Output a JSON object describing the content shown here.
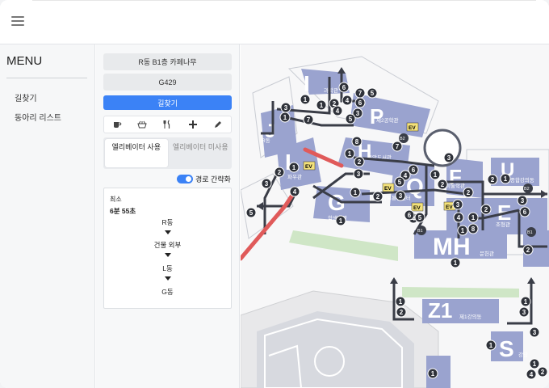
{
  "menu": {
    "title": "MENU",
    "items": [
      {
        "label": "길찾기"
      },
      {
        "label": "동아리 리스트"
      }
    ]
  },
  "route_form": {
    "origin": "R동 B1층 카페나무",
    "destination": "G429",
    "search_label": "길찾기",
    "icons": [
      "cafe-icon",
      "restaurant-icon",
      "utensils-icon",
      "plus-icon",
      "pencil-icon"
    ],
    "tabs": [
      {
        "label": "엘리베이터 사용",
        "active": true
      },
      {
        "label": "엘리베이터 미사용",
        "active": false
      }
    ],
    "simplify_toggle": {
      "label": "경로 간략화",
      "on": true
    }
  },
  "route_result": {
    "type": "최소",
    "time": "6분 55초",
    "steps": [
      "R동",
      "건물 외부",
      "L동",
      "G동"
    ]
  },
  "map": {
    "building_color": "#9aa3cf",
    "route_color": "#e05a5a",
    "buildings": [
      {
        "letter": "I",
        "name": "과학관"
      },
      {
        "letter": "P",
        "name": "제2공학관"
      },
      {
        "letter": "J",
        "name": "R동"
      },
      {
        "letter": "L",
        "name": "파우관"
      },
      {
        "letter": "H",
        "name": "중앙도서관"
      },
      {
        "letter": "Q",
        "name": "정보통신센터"
      },
      {
        "letter": "G",
        "name": "학생회관"
      },
      {
        "letter": "F",
        "name": "미술학관"
      },
      {
        "letter": "U",
        "name": "미술종합강의동"
      },
      {
        "letter": "E",
        "name": "조형관"
      },
      {
        "letter": "MH",
        "name": "문헌관"
      },
      {
        "letter": "Z1",
        "name": "제1강의동"
      },
      {
        "letter": "S",
        "name": "강당"
      }
    ],
    "badges": [
      "EV",
      "EV",
      "EV",
      "EV",
      "EV",
      "B2",
      "B2",
      "B1",
      "B1"
    ],
    "markers": [
      "1",
      "1",
      "2",
      "3",
      "1",
      "4",
      "5",
      "6",
      "6",
      "7",
      "3",
      "4",
      "5",
      "7",
      "8",
      "1",
      "2",
      "3",
      "4",
      "5",
      "6",
      "7",
      "1",
      "2",
      "3",
      "4",
      "5",
      "6",
      "1",
      "2",
      "3",
      "4",
      "5",
      "1",
      "2",
      "3",
      "1",
      "2",
      "3",
      "4",
      "1",
      "2",
      "3",
      "6",
      "8",
      "1",
      "2",
      "1",
      "2",
      "1",
      "1",
      "2",
      "3",
      "1",
      "1",
      "3",
      "1",
      "4",
      "1",
      "2"
    ]
  }
}
